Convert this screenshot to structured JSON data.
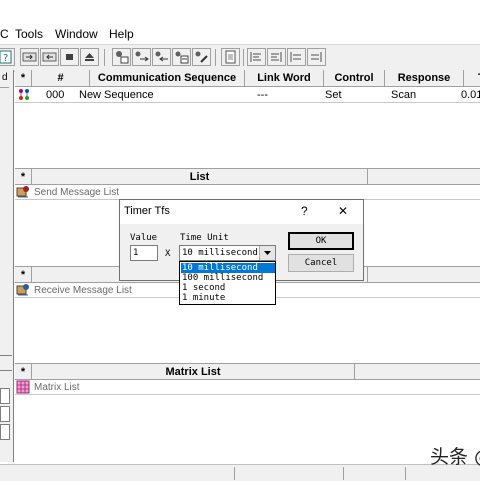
{
  "menubar": {
    "items": [
      "C",
      "Tools",
      "Window",
      "Help"
    ]
  },
  "sequence_table": {
    "columns": [
      "*",
      "#",
      "Communication Sequence",
      "Link Word",
      "Control",
      "Response",
      "Tim"
    ],
    "rows": [
      {
        "num": "000",
        "name": "New Sequence",
        "link_word": "---",
        "control": "Set",
        "response": "Scan",
        "time": "0.01"
      }
    ]
  },
  "send_table": {
    "star": "*",
    "header": "List",
    "item": "Send Message List"
  },
  "receive_table": {
    "star": "*",
    "item": "Receive Message List"
  },
  "matrix_table": {
    "star": "*",
    "header": "Matrix List",
    "item": "Matrix List"
  },
  "dialog": {
    "title": "Timer Tfs",
    "help_glyph": "?",
    "close_glyph": "✕",
    "value_label": "Value",
    "value": "1",
    "multiply": "X",
    "time_unit_label": "Time Unit",
    "time_unit_selected": "10 millisecond",
    "ok_label": "OK",
    "cancel_label": "Cancel",
    "options": [
      "10 millisecond",
      "100 millisecond",
      "1 second",
      "1 minute"
    ]
  },
  "watermark": "头条 @",
  "colors": {
    "selection": "#0078d7",
    "chrome": "#f0f0f0"
  }
}
